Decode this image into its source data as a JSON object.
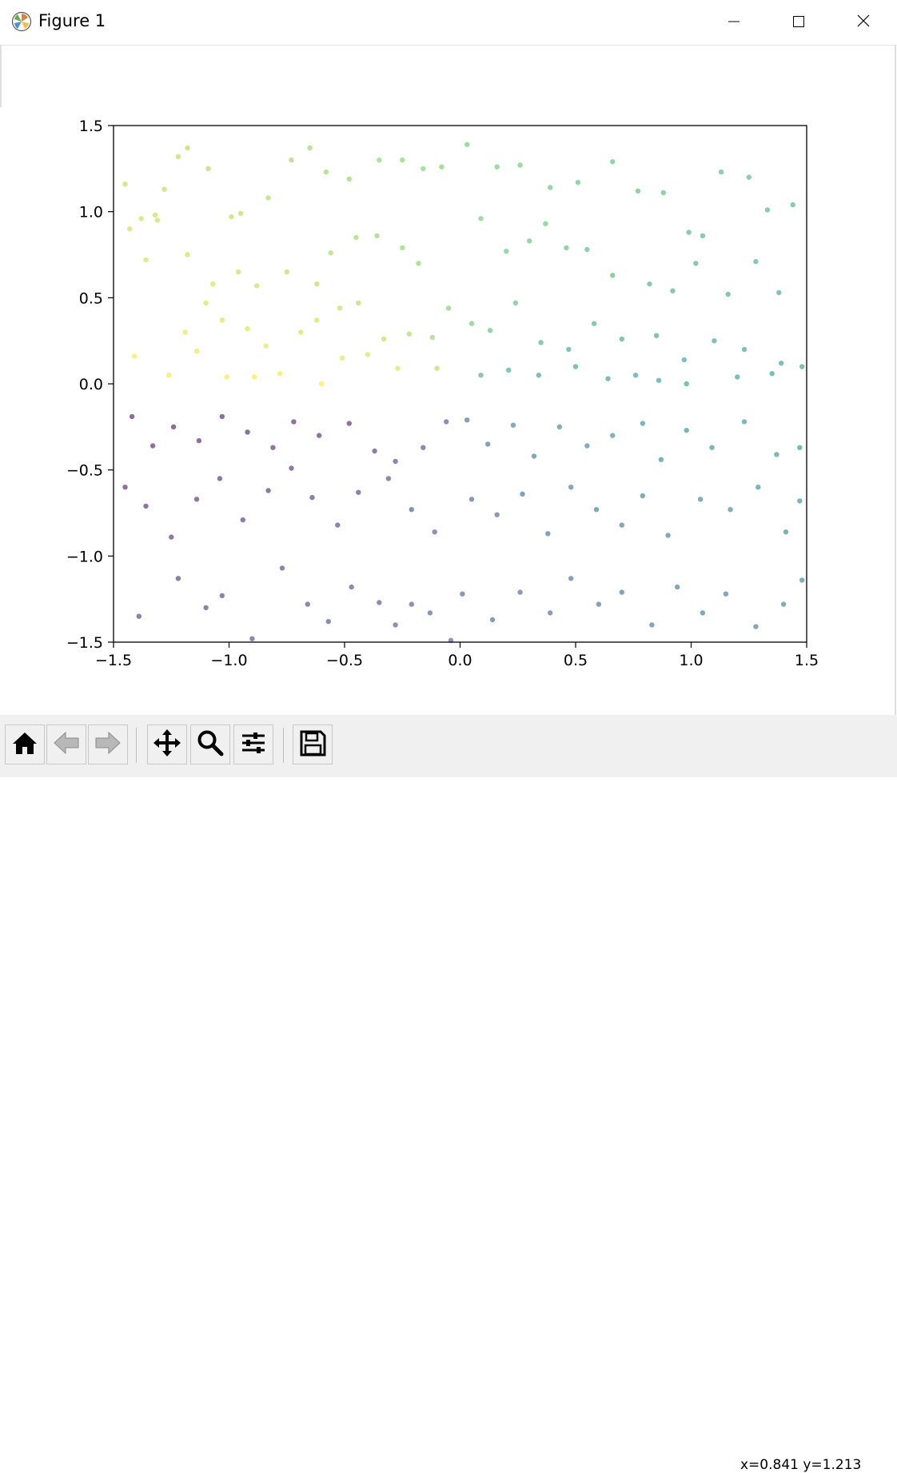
{
  "window": {
    "title": "Figure 1",
    "icon": "matplotlib-logo-icon",
    "controls": [
      "minimize-icon",
      "maximize-icon",
      "close-icon"
    ]
  },
  "toolbar": {
    "buttons": [
      {
        "name": "home-button",
        "icon": "home-icon"
      },
      {
        "name": "back-button",
        "icon": "arrow-left-icon"
      },
      {
        "name": "forward-button",
        "icon": "arrow-right-icon"
      },
      {
        "name": "pan-button",
        "icon": "move-arrows-icon"
      },
      {
        "name": "zoom-button",
        "icon": "magnifier-icon"
      },
      {
        "name": "configure-subplots-button",
        "icon": "sliders-icon"
      },
      {
        "name": "save-button",
        "icon": "floppy-disk-icon"
      }
    ],
    "coordinates": "x=0.841 y=1.213"
  },
  "chart_data": {
    "type": "scatter",
    "title": "",
    "xlabel": "",
    "ylabel": "",
    "xlim": [
      -1.5,
      1.5
    ],
    "ylim": [
      -1.5,
      1.5
    ],
    "xticks": [
      "−1.5",
      "−1.0",
      "−0.5",
      "0.0",
      "0.5",
      "1.0",
      "1.5"
    ],
    "yticks": [
      "1.5",
      "1.0",
      "0.5",
      "0.0",
      "−0.5",
      "−1.0",
      "−1.5"
    ],
    "colormap": "viridis",
    "color_rule": "point color encodes the angle of (x, y) around the origin",
    "marker_alpha": 0.6,
    "grid": false,
    "points": [
      [
        -1.43,
        0.9
      ],
      [
        -1.38,
        0.96
      ],
      [
        -1.31,
        0.95
      ],
      [
        -1.28,
        1.13
      ],
      [
        -1.22,
        1.32
      ],
      [
        -1.18,
        1.37
      ],
      [
        -1.09,
        1.25
      ],
      [
        -0.99,
        0.97
      ],
      [
        -0.95,
        0.99
      ],
      [
        -0.83,
        1.08
      ],
      [
        -0.73,
        1.3
      ],
      [
        -0.65,
        1.37
      ],
      [
        -0.58,
        1.23
      ],
      [
        -0.48,
        1.19
      ],
      [
        -0.35,
        1.3
      ],
      [
        -0.25,
        1.3
      ],
      [
        -0.16,
        1.25
      ],
      [
        -0.08,
        1.26
      ],
      [
        -1.45,
        1.16
      ],
      [
        -1.32,
        0.98
      ],
      [
        -1.36,
        0.72
      ],
      [
        -1.18,
        0.75
      ],
      [
        -1.07,
        0.58
      ],
      [
        -0.96,
        0.65
      ],
      [
        -0.88,
        0.57
      ],
      [
        -0.75,
        0.65
      ],
      [
        -0.62,
        0.58
      ],
      [
        -0.56,
        0.76
      ],
      [
        -0.45,
        0.85
      ],
      [
        -0.36,
        0.86
      ],
      [
        -0.25,
        0.79
      ],
      [
        -0.18,
        0.7
      ],
      [
        -1.41,
        0.16
      ],
      [
        -1.19,
        0.3
      ],
      [
        -1.1,
        0.47
      ],
      [
        -1.03,
        0.37
      ],
      [
        -0.92,
        0.32
      ],
      [
        -0.84,
        0.22
      ],
      [
        -0.69,
        0.3
      ],
      [
        -0.62,
        0.37
      ],
      [
        -0.52,
        0.44
      ],
      [
        -0.44,
        0.47
      ],
      [
        -0.33,
        0.26
      ],
      [
        -0.22,
        0.29
      ],
      [
        -0.12,
        0.27
      ],
      [
        -0.05,
        0.44
      ],
      [
        -1.26,
        0.05
      ],
      [
        -1.14,
        0.19
      ],
      [
        -1.01,
        0.04
      ],
      [
        -0.89,
        0.04
      ],
      [
        -0.78,
        0.06
      ],
      [
        -0.6,
        0.0
      ],
      [
        -0.51,
        0.15
      ],
      [
        -0.4,
        0.17
      ],
      [
        -0.27,
        0.09
      ],
      [
        -0.1,
        0.09
      ],
      [
        0.03,
        1.39
      ],
      [
        0.16,
        1.26
      ],
      [
        0.26,
        1.27
      ],
      [
        0.39,
        1.14
      ],
      [
        0.51,
        1.17
      ],
      [
        0.66,
        1.29
      ],
      [
        0.77,
        1.12
      ],
      [
        0.88,
        1.11
      ],
      [
        0.99,
        0.88
      ],
      [
        1.05,
        0.86
      ],
      [
        1.13,
        1.23
      ],
      [
        1.25,
        1.2
      ],
      [
        1.33,
        1.01
      ],
      [
        1.44,
        1.04
      ],
      [
        0.09,
        0.96
      ],
      [
        0.2,
        0.77
      ],
      [
        0.3,
        0.83
      ],
      [
        0.37,
        0.93
      ],
      [
        0.46,
        0.79
      ],
      [
        0.55,
        0.78
      ],
      [
        0.66,
        0.63
      ],
      [
        0.82,
        0.58
      ],
      [
        0.92,
        0.54
      ],
      [
        1.02,
        0.7
      ],
      [
        1.16,
        0.52
      ],
      [
        1.28,
        0.71
      ],
      [
        1.38,
        0.53
      ],
      [
        0.05,
        0.35
      ],
      [
        0.13,
        0.31
      ],
      [
        0.24,
        0.47
      ],
      [
        0.35,
        0.24
      ],
      [
        0.47,
        0.2
      ],
      [
        0.58,
        0.35
      ],
      [
        0.7,
        0.26
      ],
      [
        0.85,
        0.28
      ],
      [
        0.97,
        0.14
      ],
      [
        1.1,
        0.25
      ],
      [
        1.23,
        0.2
      ],
      [
        1.39,
        0.12
      ],
      [
        1.48,
        0.1
      ],
      [
        0.09,
        0.05
      ],
      [
        0.21,
        0.08
      ],
      [
        0.34,
        0.05
      ],
      [
        0.5,
        0.1
      ],
      [
        0.64,
        0.03
      ],
      [
        0.76,
        0.05
      ],
      [
        0.86,
        0.02
      ],
      [
        0.98,
        0.0
      ],
      [
        1.2,
        0.04
      ],
      [
        1.35,
        0.06
      ],
      [
        -1.42,
        -0.19
      ],
      [
        -1.33,
        -0.36
      ],
      [
        -1.24,
        -0.25
      ],
      [
        -1.13,
        -0.33
      ],
      [
        -1.03,
        -0.19
      ],
      [
        -0.92,
        -0.28
      ],
      [
        -0.81,
        -0.37
      ],
      [
        -0.72,
        -0.22
      ],
      [
        -0.61,
        -0.3
      ],
      [
        -0.48,
        -0.23
      ],
      [
        -0.37,
        -0.39
      ],
      [
        -0.28,
        -0.45
      ],
      [
        -0.16,
        -0.37
      ],
      [
        -0.06,
        -0.22
      ],
      [
        -1.45,
        -0.6
      ],
      [
        -1.36,
        -0.71
      ],
      [
        -1.25,
        -0.89
      ],
      [
        -1.14,
        -0.67
      ],
      [
        -1.04,
        -0.55
      ],
      [
        -0.94,
        -0.79
      ],
      [
        -0.83,
        -0.62
      ],
      [
        -0.73,
        -0.49
      ],
      [
        -0.64,
        -0.66
      ],
      [
        -0.53,
        -0.82
      ],
      [
        -0.44,
        -0.63
      ],
      [
        -0.31,
        -0.55
      ],
      [
        -0.21,
        -0.73
      ],
      [
        -0.11,
        -0.86
      ],
      [
        -1.39,
        -1.35
      ],
      [
        -1.22,
        -1.13
      ],
      [
        -1.1,
        -1.3
      ],
      [
        -1.03,
        -1.23
      ],
      [
        -0.9,
        -1.48
      ],
      [
        -0.77,
        -1.07
      ],
      [
        -0.66,
        -1.28
      ],
      [
        -0.57,
        -1.38
      ],
      [
        -0.47,
        -1.18
      ],
      [
        -0.35,
        -1.27
      ],
      [
        -0.28,
        -1.4
      ],
      [
        -0.21,
        -1.28
      ],
      [
        -0.13,
        -1.33
      ],
      [
        -0.04,
        -1.49
      ],
      [
        0.03,
        -0.21
      ],
      [
        0.12,
        -0.35
      ],
      [
        0.23,
        -0.24
      ],
      [
        0.32,
        -0.42
      ],
      [
        0.43,
        -0.25
      ],
      [
        0.55,
        -0.36
      ],
      [
        0.66,
        -0.3
      ],
      [
        0.79,
        -0.23
      ],
      [
        0.87,
        -0.44
      ],
      [
        0.98,
        -0.27
      ],
      [
        1.09,
        -0.37
      ],
      [
        1.23,
        -0.22
      ],
      [
        1.37,
        -0.41
      ],
      [
        1.47,
        -0.37
      ],
      [
        0.05,
        -0.67
      ],
      [
        0.16,
        -0.76
      ],
      [
        0.27,
        -0.64
      ],
      [
        0.38,
        -0.87
      ],
      [
        0.48,
        -0.6
      ],
      [
        0.59,
        -0.73
      ],
      [
        0.7,
        -0.82
      ],
      [
        0.79,
        -0.65
      ],
      [
        0.9,
        -0.88
      ],
      [
        1.04,
        -0.67
      ],
      [
        1.17,
        -0.73
      ],
      [
        1.29,
        -0.6
      ],
      [
        1.41,
        -0.86
      ],
      [
        1.47,
        -0.68
      ],
      [
        0.01,
        -1.22
      ],
      [
        0.14,
        -1.37
      ],
      [
        0.26,
        -1.21
      ],
      [
        0.39,
        -1.33
      ],
      [
        0.48,
        -1.13
      ],
      [
        0.6,
        -1.28
      ],
      [
        0.7,
        -1.21
      ],
      [
        0.83,
        -1.4
      ],
      [
        0.94,
        -1.18
      ],
      [
        1.05,
        -1.33
      ],
      [
        1.15,
        -1.22
      ],
      [
        1.28,
        -1.41
      ],
      [
        1.4,
        -1.28
      ],
      [
        1.48,
        -1.14
      ]
    ]
  }
}
